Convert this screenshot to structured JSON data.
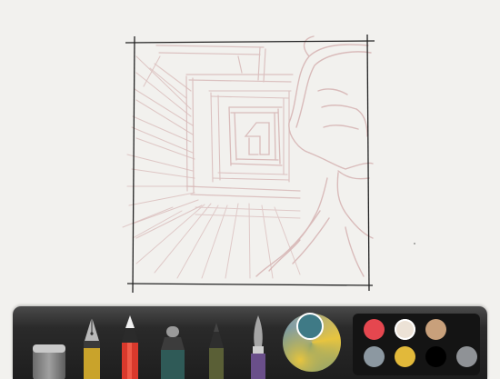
{
  "app": {
    "background": "#f2f1ee",
    "sketch_color": "#d8b9b8",
    "frame_color": "#222222"
  },
  "toolbar": {
    "tools": [
      {
        "name": "eraser-tool",
        "icon": "eraser-icon",
        "active": false
      },
      {
        "name": "fountain-pen-tool",
        "icon": "fountain-pen-icon",
        "active": false
      },
      {
        "name": "pencil-tool",
        "icon": "pencil-icon",
        "active": true
      },
      {
        "name": "marker-tool",
        "icon": "marker-icon",
        "active": false
      },
      {
        "name": "fineliner-tool",
        "icon": "fineliner-icon",
        "active": false
      },
      {
        "name": "watercolor-brush-tool",
        "icon": "brush-icon",
        "active": false
      }
    ],
    "current_color": "#3f7a86",
    "mixer_colors": [
      "#4e8a8f",
      "#e7c43f",
      "#8aa0a4"
    ]
  },
  "swatches": [
    {
      "color": "#e5474f",
      "selected": false
    },
    {
      "color": "#ece2d6",
      "selected": true
    },
    {
      "color": "#c8a07b",
      "selected": false
    },
    {
      "color": "#8c98a1",
      "selected": false
    },
    {
      "color": "#e2b93a",
      "selected": false
    },
    {
      "color": "#000000",
      "selected": false
    },
    {
      "color": "#8f9296",
      "selected": false
    }
  ]
}
